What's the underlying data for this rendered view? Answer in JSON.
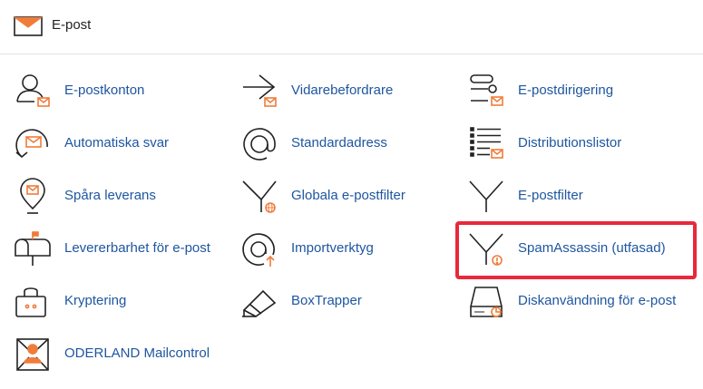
{
  "header": {
    "title": "E-post",
    "icon": "envelope-icon"
  },
  "items": [
    {
      "label": "E-postkonton",
      "icon": "email-accounts-icon"
    },
    {
      "label": "Vidarebefordrare",
      "icon": "forwarders-icon"
    },
    {
      "label": "E-postdirigering",
      "icon": "email-routing-icon"
    },
    {
      "label": "Automatiska svar",
      "icon": "autoresponders-icon"
    },
    {
      "label": "Standardadress",
      "icon": "default-address-icon"
    },
    {
      "label": "Distributionslistor",
      "icon": "mailing-lists-icon"
    },
    {
      "label": "Spåra leverans",
      "icon": "track-delivery-icon"
    },
    {
      "label": "Globala e-postfilter",
      "icon": "global-filters-icon"
    },
    {
      "label": "E-postfilter",
      "icon": "email-filters-icon"
    },
    {
      "label": "Levererbarhet för e-post",
      "icon": "deliverability-icon"
    },
    {
      "label": "Importverktyg",
      "icon": "import-tool-icon"
    },
    {
      "label": "SpamAssassin (utfasad)",
      "icon": "spam-filter-icon"
    },
    {
      "label": "Kryptering",
      "icon": "encryption-icon"
    },
    {
      "label": "BoxTrapper",
      "icon": "boxtrapper-icon"
    },
    {
      "label": "Diskanvändning för e-post",
      "icon": "disk-usage-icon"
    },
    {
      "label": "ODERLAND Mailcontrol",
      "icon": "mailcontrol-icon"
    }
  ],
  "colors": {
    "link": "#1e56a0",
    "accent": "#f07c3a",
    "highlight": "#e8283c",
    "icon_stroke": "#222222"
  }
}
